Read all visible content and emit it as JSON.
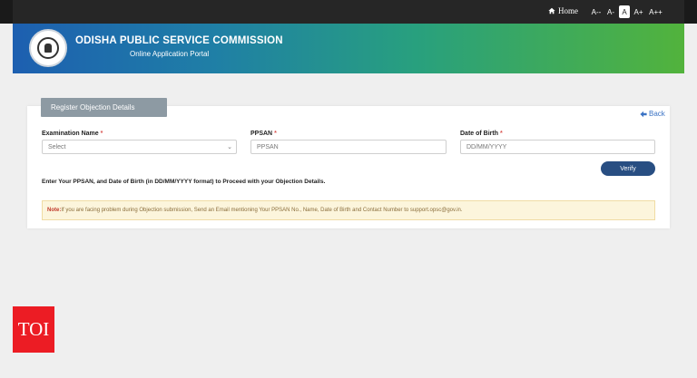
{
  "topbar": {
    "home_label": "Home",
    "font_sizes": [
      "A--",
      "A-",
      "A",
      "A+",
      "A++"
    ],
    "active_font_size": "A"
  },
  "header": {
    "title": "ODISHA PUBLIC SERVICE COMMISSION",
    "subtitle": "Online Application Portal"
  },
  "form": {
    "section_tab": "Register Objection Details",
    "back_label": "Back",
    "exam_name_label": "Examination Name",
    "exam_name_value": "Select",
    "ppsan_label": "PPSAN",
    "ppsan_placeholder": "PPSAN",
    "dob_label": "Date of Birth",
    "dob_placeholder": "DD/MM/YYYY",
    "required_mark": "*",
    "verify_label": "Verify",
    "instruction": "Enter Your PPSAN, and Date of Birth (in DD/MM/YYYY format) to Proceed with your Objection Details.",
    "note_prefix": "Note:",
    "note_text": "If you are facing problem during Objection submission, Send an Email mentioning Your PPSAN No., Name, Date of Birth and Contact Number to support.opsc@gov.in."
  },
  "watermark": {
    "text": "TOI"
  },
  "colors": {
    "accent": "#284e82",
    "header_start": "#1d5fb0",
    "header_end": "#52b33c",
    "note_bg": "#fcf5dc",
    "required": "#d9534f",
    "watermark_bg": "#ec1c24"
  }
}
